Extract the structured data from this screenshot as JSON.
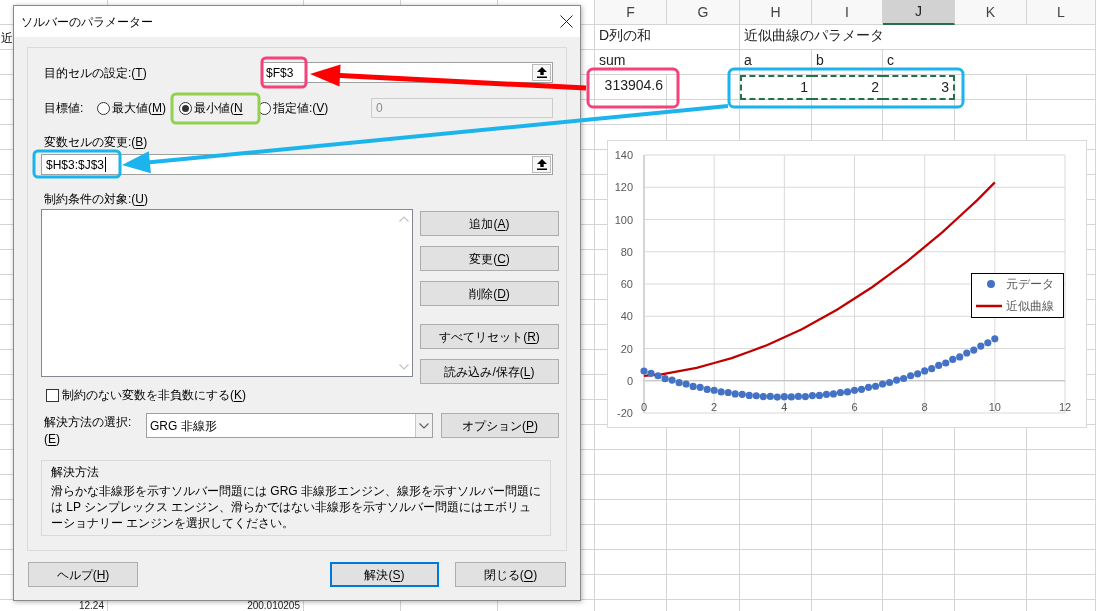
{
  "sheet": {
    "columns": [
      {
        "label": "F",
        "selected": false
      },
      {
        "label": "G",
        "selected": false
      },
      {
        "label": "H",
        "selected": false
      },
      {
        "label": "I",
        "selected": false
      },
      {
        "label": "J",
        "selected": true
      },
      {
        "label": "K",
        "selected": false
      },
      {
        "label": "L",
        "selected": false
      }
    ],
    "rows": [
      {
        "left_edge_text": "近",
        "cells": [
          {
            "text": "D列の和",
            "kind": "text",
            "marquee": false
          },
          null,
          {
            "text": "近似曲線のパラメータ",
            "kind": "text",
            "marquee": false
          },
          null,
          null,
          null,
          null
        ]
      },
      {
        "cells": [
          {
            "text": "sum",
            "kind": "text",
            "marquee": false
          },
          null,
          {
            "text": "a",
            "kind": "text",
            "marquee": false
          },
          {
            "text": "b",
            "kind": "text",
            "marquee": false
          },
          {
            "text": "c",
            "kind": "text",
            "marquee": false
          },
          null,
          null
        ]
      },
      {
        "cells": [
          {
            "text": "313904.6",
            "kind": "number",
            "marquee": false
          },
          null,
          {
            "text": "1",
            "kind": "number",
            "marquee": true
          },
          {
            "text": "2",
            "kind": "number",
            "marquee": true
          },
          {
            "text": "3",
            "kind": "number",
            "marquee": true
          },
          null,
          null
        ]
      }
    ],
    "bottom_row": [
      {
        "text": "12.24",
        "kind": "number"
      },
      {
        "text": "200.010205",
        "kind": "number"
      }
    ]
  },
  "chart": {
    "chart_data": [
      {
        "type": "scatter",
        "series": [
          {
            "name": "元データ",
            "type": "scatter",
            "color": "#4472c4",
            "x": [
              0,
              0.2,
              0.4,
              0.6,
              0.8,
              1,
              1.2,
              1.4,
              1.6,
              1.8,
              2,
              2.2,
              2.4,
              2.6,
              2.8,
              3,
              3.2,
              3.4,
              3.6,
              3.8,
              4,
              4.2,
              4.4,
              4.6,
              4.8,
              5,
              5.2,
              5.4,
              5.6,
              5.8,
              6,
              6.2,
              6.4,
              6.6,
              6.8,
              7,
              7.2,
              7.4,
              7.6,
              7.8,
              8,
              8.2,
              8.4,
              8.6,
              8.8,
              9,
              9.2,
              9.4,
              9.6,
              9.8,
              10
            ],
            "values": [
              6.0,
              4.6,
              3.1,
              1.3,
              0.4,
              -1.2,
              -2.0,
              -3.5,
              -4.1,
              -5.4,
              -5.9,
              -6.9,
              -7.3,
              -8.2,
              -8.4,
              -9.1,
              -9.3,
              -9.8,
              -9.7,
              -10.1,
              -9.9,
              -10.0,
              -9.7,
              -9.8,
              -9.2,
              -9.1,
              -8.4,
              -8.2,
              -7.3,
              -6.9,
              -5.9,
              -5.3,
              -4.1,
              -3.4,
              -2.0,
              -1.1,
              0.4,
              1.4,
              3.1,
              4.3,
              6.1,
              7.5,
              9.5,
              11.0,
              13.2,
              14.8,
              17.2,
              19.0,
              21.5,
              23.5,
              26.0
            ]
          },
          {
            "name": "近似曲線",
            "type": "line",
            "color": "#c00000",
            "x": [
              0,
              0.5,
              1,
              1.5,
              2,
              2.5,
              3,
              3.5,
              4,
              4.5,
              5,
              5.5,
              6,
              6.5,
              7,
              7.5,
              8,
              8.5,
              9,
              9.5,
              10
            ],
            "values": [
              3,
              4,
              6,
              8,
              11,
              14,
              18,
              22,
              27,
              32,
              38,
              44,
              51,
              58,
              66,
              74,
              83,
              92,
              102,
              112,
              123
            ]
          }
        ],
        "xlim": [
          0,
          12
        ],
        "ylim": [
          -20,
          140
        ],
        "xticks": [
          0,
          2,
          4,
          6,
          8,
          10,
          12
        ],
        "yticks": [
          -20,
          0,
          20,
          40,
          60,
          80,
          100,
          120,
          140
        ],
        "grid": true,
        "legend": "right"
      }
    ]
  },
  "dialog": {
    "title": "ソルバーのパラメーター",
    "objective": {
      "label": "目的セルの設定:(",
      "key": "T",
      "label_end": ")",
      "value": "$F$3"
    },
    "target": {
      "label": "目標値:",
      "options": [
        {
          "label": "最大値(",
          "key": "M",
          "label_end": ")",
          "selected": false
        },
        {
          "label": "最小値(",
          "key": "N",
          "selected": true
        },
        {
          "label": "指定値:(",
          "key": "V",
          "label_end": ")",
          "selected": false
        }
      ],
      "value_field": {
        "value": "0",
        "disabled": true
      }
    },
    "variables": {
      "label": "変数セルの変更:(",
      "key": "B",
      "label_end": ")",
      "value": "$H$3:$J$3",
      "focused": true
    },
    "constraints": {
      "label": "制約条件の対象:(",
      "key": "U",
      "label_end": ")",
      "buttons": [
        [
          {
            "label": "追加(",
            "key": "A",
            "label_end": ")"
          },
          {
            "label": "変更(",
            "key": "C",
            "label_end": ")"
          },
          {
            "label": "削除(",
            "key": "D",
            "label_end": ")"
          }
        ],
        [
          {
            "label": "すべてリセット(",
            "key": "R",
            "label_end": ")"
          },
          {
            "label": "読み込み/保存(",
            "key": "L",
            "label_end": ")"
          }
        ]
      ]
    },
    "nonnegative": {
      "label": "制約のない変数を非負数にする(",
      "key": "K",
      "label_end": ")",
      "checked": false
    },
    "method": {
      "label": "解決方法の選択:",
      "label_line2": "(",
      "key": "E",
      "label_end": ")",
      "value": "GRG 非線形",
      "options_button": {
        "label": "オプション(",
        "key": "P",
        "label_end": ")"
      }
    },
    "description": {
      "title": "解決方法",
      "text": "滑らかな非線形を示すソルバー問題には GRG 非線形エンジン、線形を示すソルバー問題には LP シンプレックス エンジン、滑らかではない非線形を示すソルバー問題にはエボリューショナリー エンジンを選択してください。"
    },
    "buttons": [
      {
        "label": "ヘルプ(",
        "key": "H",
        "label_end": ")",
        "default": false
      },
      {
        "label": "解決(",
        "key": "S",
        "label_end": ")",
        "default": true
      },
      {
        "label": "閉じる(",
        "key": "O",
        "label_end": ")",
        "default": false
      }
    ]
  }
}
